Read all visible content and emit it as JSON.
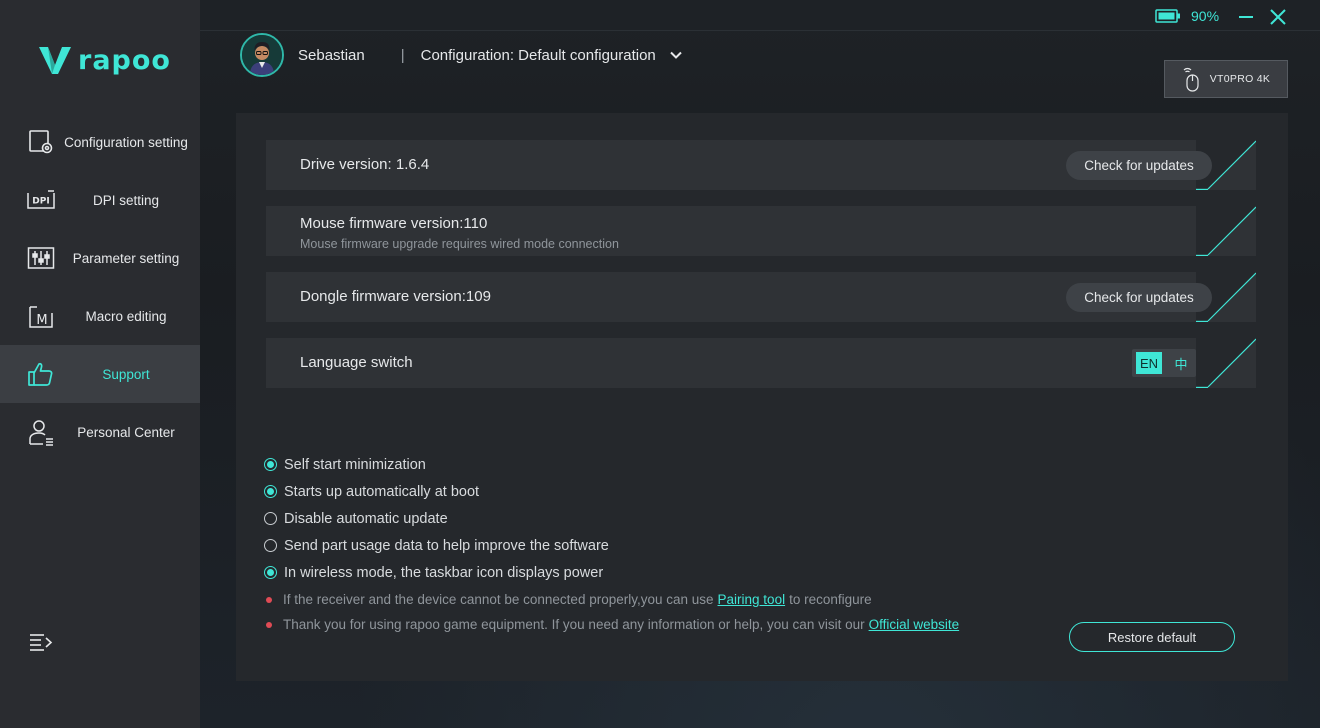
{
  "app": {
    "logo_text": "rapoo",
    "accent_color": "#3fe6d6"
  },
  "sidebar": {
    "items": [
      {
        "label": "Configuration setting",
        "icon": "configuration-icon",
        "active": false
      },
      {
        "label": "DPI setting",
        "icon": "dpi-icon",
        "active": false
      },
      {
        "label": "Parameter setting",
        "icon": "sliders-icon",
        "active": false
      },
      {
        "label": "Macro editing",
        "icon": "macro-icon",
        "active": false
      },
      {
        "label": "Support",
        "icon": "thumbs-up-icon",
        "active": true
      },
      {
        "label": "Personal Center",
        "icon": "user-icon",
        "active": false
      }
    ],
    "menu_icon": "menu-collapse-icon"
  },
  "header": {
    "battery_pct": "90%",
    "username": "Sebastian",
    "separator": "|",
    "configuration": "Configuration: Default configuration",
    "device_label": "VT0PRO 4K"
  },
  "support": {
    "drive": {
      "title": "Drive version: 1.6.4",
      "button": "Check for updates"
    },
    "mouse_fw": {
      "title": "Mouse firmware version:110",
      "subtitle": "Mouse firmware upgrade requires wired mode connection"
    },
    "dongle_fw": {
      "title": "Dongle firmware version:109",
      "button": "Check for updates"
    },
    "language": {
      "title": "Language switch",
      "en": "EN",
      "zh": "中",
      "selected": "EN"
    },
    "options": [
      {
        "label": "Self start minimization",
        "checked": true
      },
      {
        "label": "Starts up automatically at boot",
        "checked": true
      },
      {
        "label": "Disable automatic update",
        "checked": false
      },
      {
        "label": "Send part usage data to help improve the software",
        "checked": false
      },
      {
        "label": "In wireless mode, the taskbar icon displays power",
        "checked": true
      }
    ],
    "notes": {
      "pairing_before": "If the receiver and the device cannot be connected properly,you can use",
      "pairing_link": "Pairing tool",
      "pairing_after": "to reconfigure",
      "website_before": "Thank you for using rapoo game equipment. If you need any information or help, you can visit our",
      "website_link": "Official website"
    },
    "restore_button": "Restore default"
  }
}
